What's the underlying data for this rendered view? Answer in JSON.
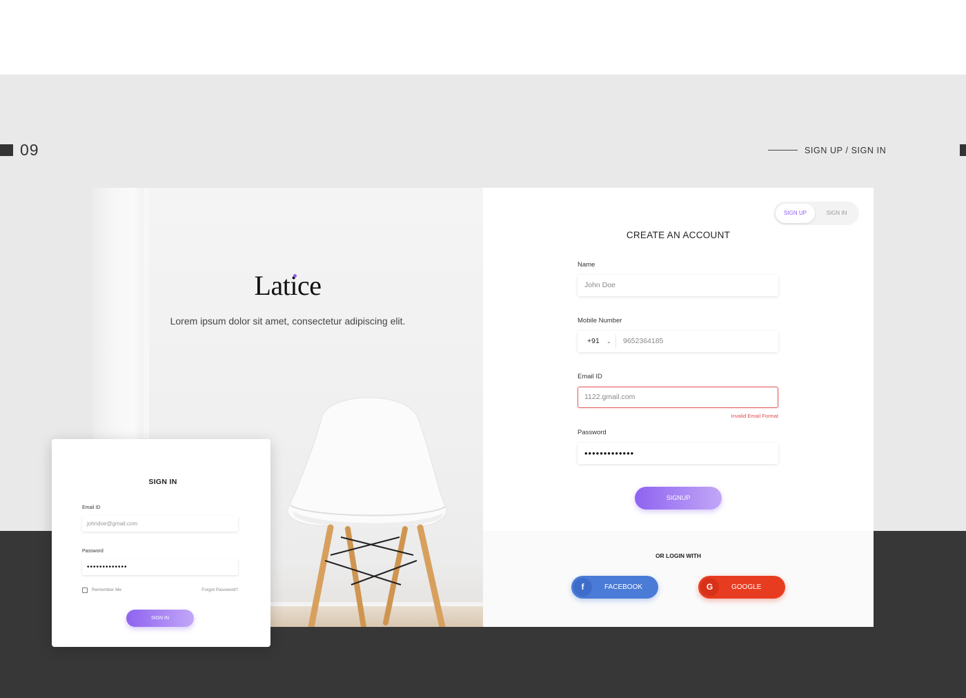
{
  "section": {
    "number": "09",
    "title": "SIGN UP / SIGN IN"
  },
  "hero": {
    "logo": "Latice",
    "tagline": "Lorem ipsum dolor sit amet, consectetur adipiscing elit."
  },
  "colors": {
    "accent": "#8b5cf6",
    "facebook": "#4a7bd6",
    "google": "#e83c20",
    "error": "#e15b5b",
    "dark_band": "#373737",
    "light_band": "#e9e9e9"
  },
  "signup": {
    "toggle": {
      "signup": "SIGN UP",
      "signin": "SIGN IN",
      "active": "SIGN UP"
    },
    "title": "CREATE AN ACCOUNT",
    "name_label": "Name",
    "name_placeholder": "John Doe",
    "mobile_label": "Mobile Number",
    "country_code": "+91",
    "mobile_value": "9652364185",
    "email_label": "Email ID",
    "email_value": "1122.gmail.com",
    "email_error": "Invalid Email Format",
    "password_label": "Password",
    "password_value": "•••••••••••••",
    "submit": "SIGNUP",
    "or_login": "OR LOGIN WITH",
    "facebook": "FACEBOOK",
    "google": "GOOGLE",
    "facebook_icon": "facebook-icon",
    "google_icon": "google-icon"
  },
  "signin": {
    "title": "SIGN IN",
    "email_label": "Email ID",
    "email_placeholder": "johndoe@gmail.com",
    "password_label": "Password",
    "password_value": "•••••••••••••",
    "remember": "Remember Me",
    "forgot": "Forgot Password?",
    "submit": "SIGN IN"
  }
}
